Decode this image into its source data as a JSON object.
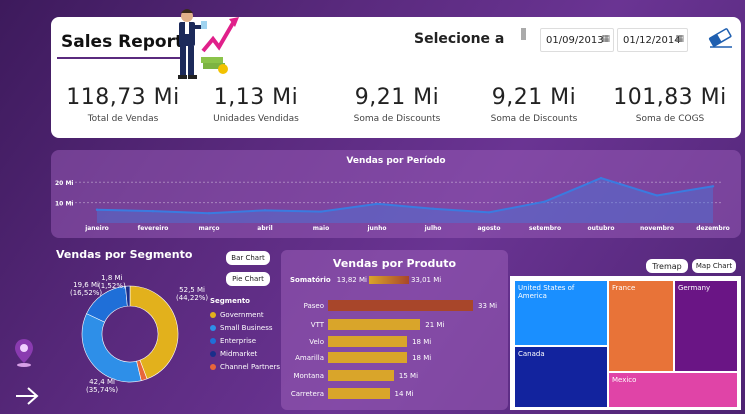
{
  "header": {
    "title": "Sales Report",
    "select_label": "Selecione a",
    "date_start": "01/09/2013",
    "date_end": "01/12/2014"
  },
  "kpis": [
    {
      "value": "118,73 Mi",
      "label": "Total de Vendas"
    },
    {
      "value": "1,13 Mi",
      "label": "Unidades Vendidas"
    },
    {
      "value": "9,21 Mi",
      "label": "Soma de Discounts"
    },
    {
      "value": "9,21 Mi",
      "label": "Soma de Discounts"
    },
    {
      "value": "101,83 Mi",
      "label": "Soma de COGS"
    }
  ],
  "period_chart": {
    "title": "Vendas por Período",
    "y_ticks": [
      "20 Mi",
      "10 Mi"
    ],
    "chart_data": {
      "type": "area",
      "categories": [
        "janeiro",
        "fevereiro",
        "março",
        "abril",
        "maio",
        "junho",
        "julho",
        "agosto",
        "setembro",
        "outubro",
        "novembro",
        "dezembro"
      ],
      "values": [
        6.5,
        5.8,
        4.8,
        6.2,
        5.6,
        9.4,
        7.0,
        5.2,
        10.5,
        22.0,
        13.5,
        18.0
      ],
      "ylim": [
        0,
        25
      ],
      "color": "#3a7be0"
    }
  },
  "segment": {
    "title": "Vendas por Segmento",
    "bar_btn": "Bar Chart",
    "pie_btn": "Pie Chart",
    "legend_title": "Segmento",
    "items": [
      {
        "name": "Government",
        "color": "#e2b11c",
        "value": 52.5
      },
      {
        "name": "Small Business",
        "color": "#2e8fe8",
        "value": 42.4
      },
      {
        "name": "Enterprise",
        "color": "#1f6fd8",
        "value": 19.6
      },
      {
        "name": "Midmarket",
        "color": "#1a2e8a",
        "value": 1.8
      },
      {
        "name": "Channel Partners",
        "color": "#e8663a",
        "value": 2.4
      }
    ],
    "labels": {
      "gov": "52,5 Mi\n(44,22%)",
      "small": "42,4 Mi\n(35,74%)",
      "ent": "19,6 Mi\n(16,52%)",
      "mid": "1,8 Mi\n(1,52%)"
    }
  },
  "product": {
    "title": "Vendas por Produto",
    "legend_label": "Somatório",
    "legend_min": "13,82 Mi",
    "legend_max": "33,01 Mi",
    "chart_data": {
      "type": "bar",
      "categories": [
        "Paseo",
        "VTT",
        "Velo",
        "Amarilla",
        "Montana",
        "Carretera"
      ],
      "values": [
        33,
        21,
        18,
        18,
        15,
        14
      ],
      "labels": [
        "33 Mi",
        "21 Mi",
        "18 Mi",
        "18 Mi",
        "15 Mi",
        "14 Mi"
      ],
      "colors": [
        "#a8462a",
        "#d9a52a",
        "#d9a52a",
        "#d9a52a",
        "#d9a52a",
        "#d9a52a"
      ]
    }
  },
  "treemap": {
    "tremap_btn": "Tremap",
    "map_btn": "Map Chart",
    "cells": [
      {
        "name": "United States of America",
        "color": "#1a8fff"
      },
      {
        "name": "France",
        "color": "#e87338"
      },
      {
        "name": "Germany",
        "color": "#6a1585"
      },
      {
        "name": "Canada",
        "color": "#12239e"
      },
      {
        "name": "Mexico",
        "color": "#e044a7"
      }
    ]
  }
}
